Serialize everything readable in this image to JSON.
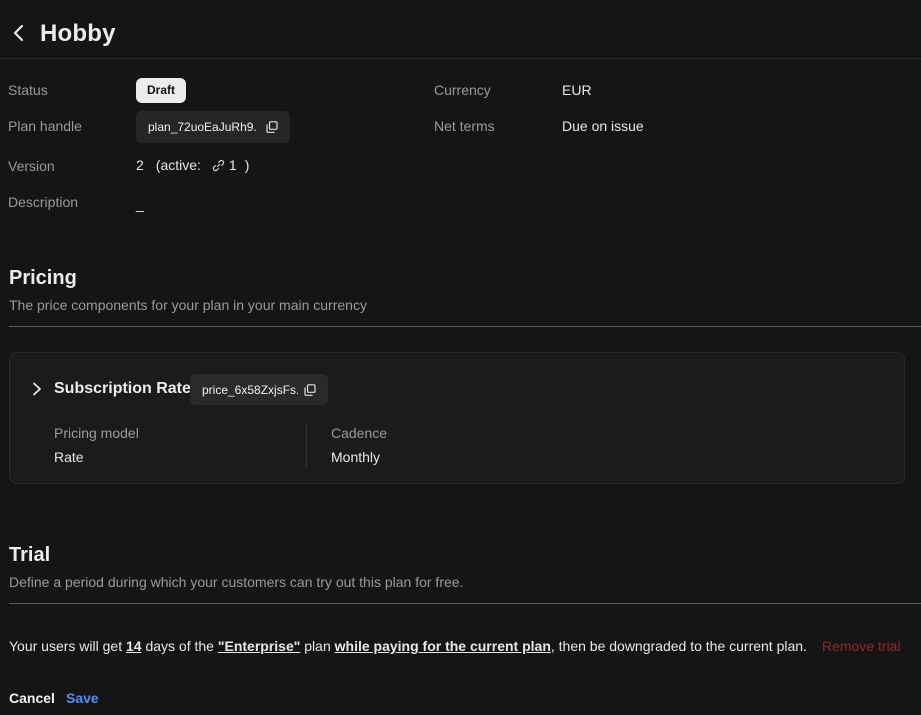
{
  "header": {
    "back_icon": "chevron-left-icon",
    "title": "Hobby"
  },
  "details": {
    "status_label": "Status",
    "status_value": "Draft",
    "plan_handle_label": "Plan handle",
    "plan_handle_value": "plan_72uoEaJuRh9...",
    "version_label": "Version",
    "version_value": "2",
    "version_active_prefix": "(active:",
    "version_active_value": "1",
    "version_active_suffix": ")",
    "description_label": "Description",
    "description_value": "_",
    "currency_label": "Currency",
    "currency_value": "EUR",
    "net_terms_label": "Net terms",
    "net_terms_value": "Due on issue"
  },
  "pricing": {
    "title": "Pricing",
    "subtitle": "The price components for your plan in your main currency",
    "component": {
      "name": "Subscription Rate",
      "price_handle": "price_6x58ZxjsFs...",
      "pricing_model_label": "Pricing model",
      "pricing_model_value": "Rate",
      "cadence_label": "Cadence",
      "cadence_value": "Monthly"
    }
  },
  "trial": {
    "title": "Trial",
    "subtitle": "Define a period during which your customers can try out this plan for free.",
    "sentence": {
      "part1": "Your users will get ",
      "days": "14",
      "part2": " days of the ",
      "plan": "\"Enterprise\"",
      "part3": " plan ",
      "condition": "while paying for the current plan",
      "part4": ", then be downgraded to the current plan."
    },
    "remove_label": "Remove trial"
  },
  "actions": {
    "cancel_label": "Cancel",
    "save_label": "Save"
  },
  "colors": {
    "background": "#151515",
    "accent": "#4f8ff0",
    "danger": "#8d2a2a",
    "badge_bg": "#ececec"
  }
}
